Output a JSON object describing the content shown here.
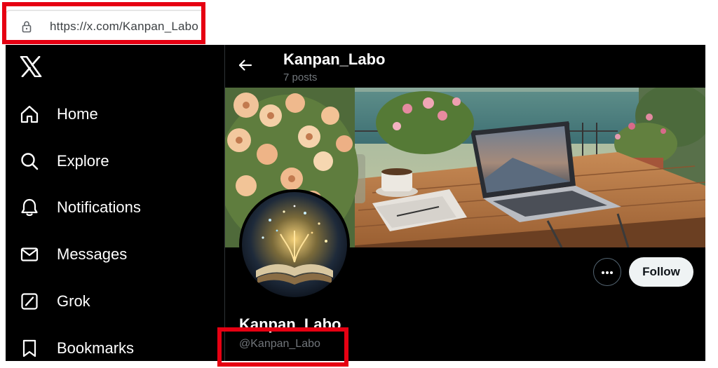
{
  "browser": {
    "url": "https://x.com/Kanpan_Labo",
    "lock_icon": "lock-icon"
  },
  "sidebar": {
    "logo_icon": "x-logo-icon",
    "items": [
      {
        "label": "Home",
        "icon": "home-icon"
      },
      {
        "label": "Explore",
        "icon": "search-icon"
      },
      {
        "label": "Notifications",
        "icon": "bell-icon"
      },
      {
        "label": "Messages",
        "icon": "envelope-icon"
      },
      {
        "label": "Grok",
        "icon": "grok-icon"
      },
      {
        "label": "Bookmarks",
        "icon": "bookmark-icon"
      }
    ]
  },
  "profile": {
    "header_name": "Kanpan_Labo",
    "posts": "7 posts",
    "display_name": "Kanpan_Labo",
    "handle": "@Kanpan_Labo",
    "follow_label": "Follow",
    "more_icon": "more-icon",
    "back_icon": "back-arrow-icon"
  },
  "colors": {
    "highlight": "#e60012",
    "background": "#000000",
    "text": "#ffffff",
    "muted": "#71767b",
    "follow_bg": "#eff3f4"
  }
}
